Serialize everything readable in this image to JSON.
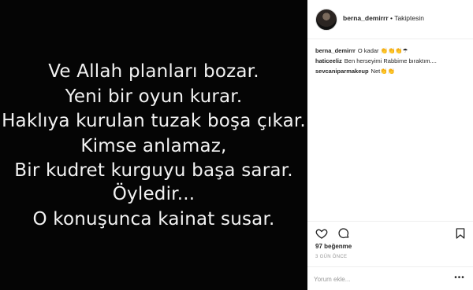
{
  "post": {
    "lines": [
      "Ve Allah planları bozar.",
      "Yeni bir oyun kurar.",
      "Haklıya kurulan tuzak boşa çıkar.",
      "Kimse anlamaz,",
      "Bir kudret kurguyu başa sarar.",
      "Öyledir...",
      "O konuşunca kainat susar."
    ]
  },
  "header": {
    "username": "berna_demirrr",
    "separator": " • ",
    "follow_status": "Takiptesin"
  },
  "comments": [
    {
      "user": "berna_demirrr",
      "text": "O kadar 👏👏👏☂"
    },
    {
      "user": "haticeeliz",
      "text": "Ben herseyimi Rabbime bıraktım...."
    },
    {
      "user": "sevcaniparmakeup",
      "text": "Net👏👏"
    }
  ],
  "actions": {
    "like_icon": "heart-icon",
    "comment_icon": "speech-bubble-icon",
    "save_icon": "bookmark-icon"
  },
  "likes": "97 beğenme",
  "timestamp": "3 GÜN ÖNCE",
  "comment_box": {
    "placeholder": "Yorum ekle...",
    "more": "•••"
  }
}
